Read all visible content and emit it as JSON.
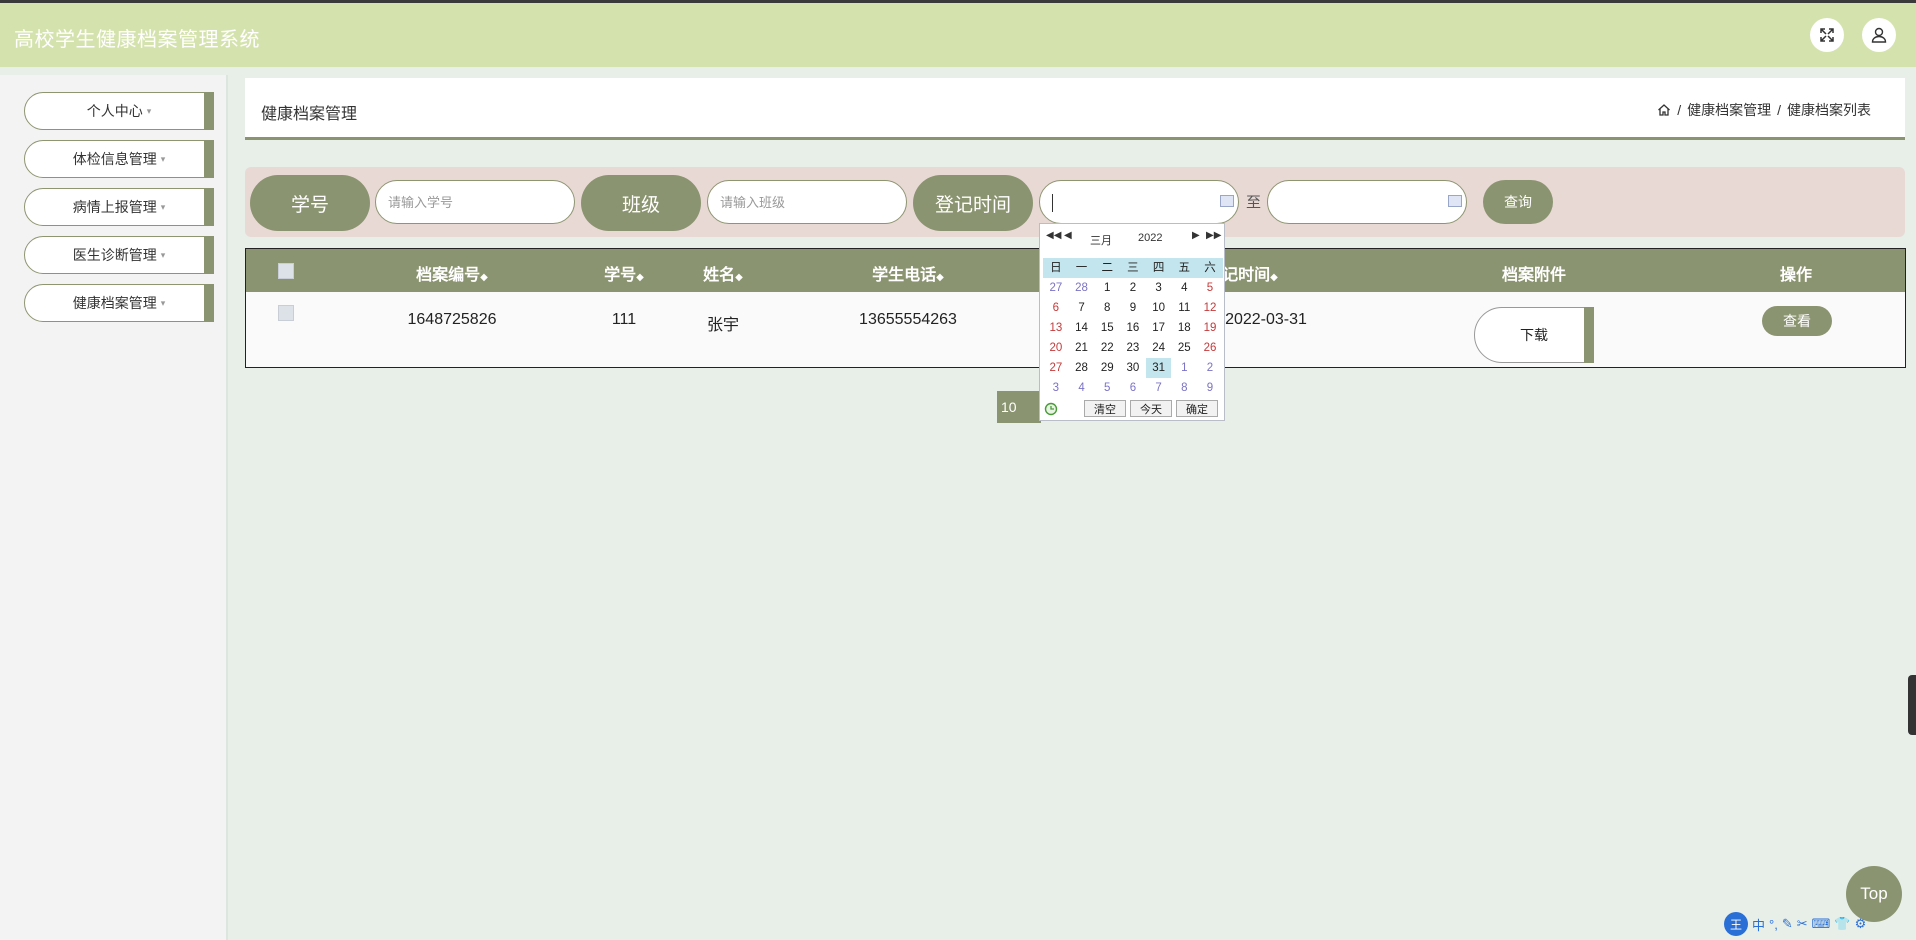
{
  "header": {
    "title": "高校学生健康档案管理系统"
  },
  "sidebar": {
    "items": [
      {
        "label": "个人中心"
      },
      {
        "label": "体检信息管理"
      },
      {
        "label": "病情上报管理"
      },
      {
        "label": "医生诊断管理"
      },
      {
        "label": "健康档案管理"
      }
    ],
    "caret": "▾"
  },
  "page": {
    "title": "健康档案管理",
    "breadcrumb": [
      "健康档案管理",
      "健康档案列表"
    ],
    "crumb_sep": "/"
  },
  "search": {
    "student_no_label": "学号",
    "student_no_placeholder": "请输入学号",
    "class_label": "班级",
    "class_placeholder": "请输入班级",
    "reg_time_label": "登记时间",
    "to_label": "至",
    "search_button": "查询"
  },
  "table": {
    "headers": [
      "档案编号",
      "学号",
      "姓名",
      "学生电话",
      "登记时间",
      "档案附件",
      "操作"
    ],
    "sort_icon": "◆",
    "rows": [
      {
        "record_no": "1648725826",
        "student_no": "111",
        "name": "张宇",
        "phone": "13655554263",
        "reg_time": "2022-03-31",
        "download_label": "下载",
        "view_label": "查看"
      }
    ]
  },
  "pager": {
    "page_size": "10"
  },
  "calendar": {
    "month": "三月",
    "year": "2022",
    "weekdays": [
      "日",
      "一",
      "二",
      "三",
      "四",
      "五",
      "六"
    ],
    "weeks": [
      [
        "27",
        "28",
        "1",
        "2",
        "3",
        "4",
        "5"
      ],
      [
        "6",
        "7",
        "8",
        "9",
        "10",
        "11",
        "12"
      ],
      [
        "13",
        "14",
        "15",
        "16",
        "17",
        "18",
        "19"
      ],
      [
        "20",
        "21",
        "22",
        "23",
        "24",
        "25",
        "26"
      ],
      [
        "27",
        "28",
        "29",
        "30",
        "31",
        "1",
        "2"
      ],
      [
        "3",
        "4",
        "5",
        "6",
        "7",
        "8",
        "9"
      ]
    ],
    "selected": "31",
    "clear": "清空",
    "today": "今天",
    "confirm": "确定"
  },
  "back_to_top": "Top",
  "ime": {
    "logo": "王",
    "lang": "中"
  },
  "colors": {
    "accent": "#8b9470",
    "header_bg": "#d4e3ad",
    "search_bg": "#e8d9d5"
  }
}
